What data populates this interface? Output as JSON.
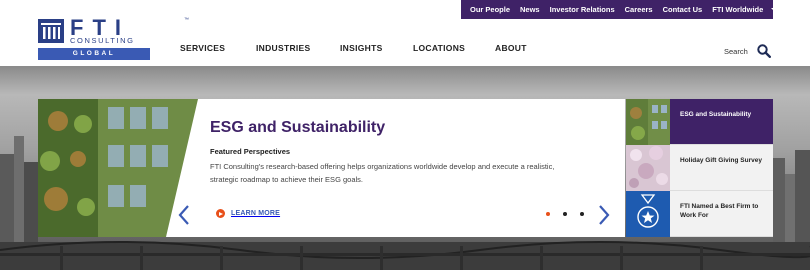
{
  "utility_nav": {
    "items": [
      "Our People",
      "News",
      "Investor Relations",
      "Careers",
      "Contact Us"
    ],
    "worldwide_label": "FTI Worldwide"
  },
  "logo": {
    "wordmark": "FTI",
    "trademark": "™",
    "subtitle": "CONSULTING",
    "region": "GLOBAL"
  },
  "main_nav": {
    "items": [
      "SERVICES",
      "INDUSTRIES",
      "INSIGHTS",
      "LOCATIONS",
      "ABOUT"
    ]
  },
  "search": {
    "label": "Search",
    "icon": "magnifier-icon"
  },
  "hero": {
    "title": "ESG and Sustainability",
    "kicker": "Featured Perspectives",
    "description": "FTI Consulting's research-based offering helps organizations worldwide develop and execute a realistic, strategic roadmap to achieve their ESG goals.",
    "cta": "LEARN MORE",
    "slide_count": 3,
    "active_slide": 1
  },
  "side_panel": {
    "items": [
      {
        "label": "ESG and Sustainability",
        "active": true
      },
      {
        "label": "Holiday Gift Giving Survey",
        "active": false
      },
      {
        "label": "FTI Named a Best Firm to Work For",
        "active": false
      }
    ]
  },
  "colors": {
    "brand_purple": "#3f2267",
    "brand_blue": "#3a5ab4",
    "accent_orange": "#e8501a"
  }
}
